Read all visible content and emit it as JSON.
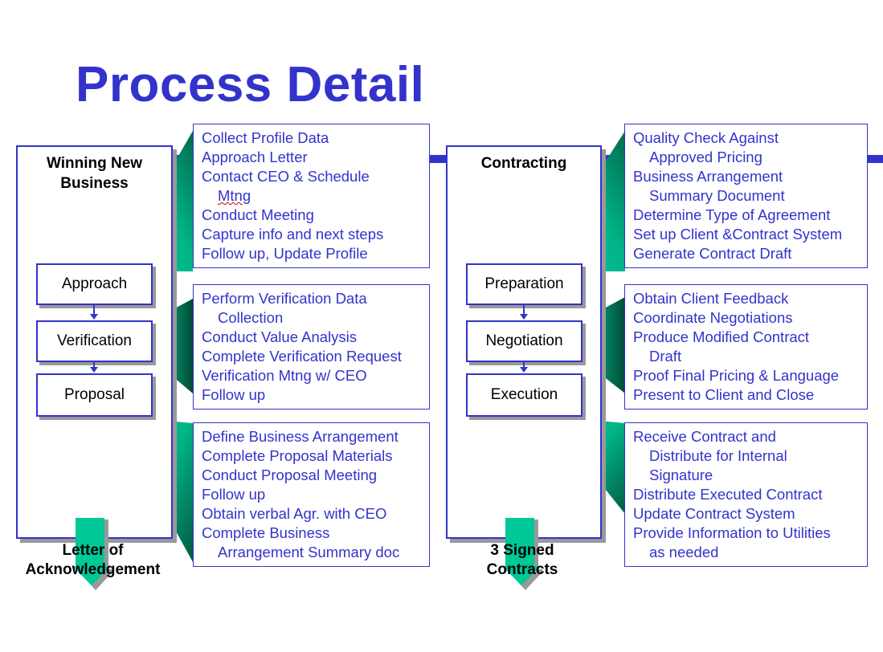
{
  "title": "Process Detail",
  "colors": {
    "accent": "#3333cc",
    "callout_light": "#00c896",
    "callout_dark": "#006a4e",
    "text_dark": "#000000"
  },
  "phases": [
    {
      "title_line1": "Winning New",
      "title_line2": "Business",
      "steps": [
        "Approach",
        "Verification",
        "Proposal"
      ],
      "output_line1": "Letter of",
      "output_line2": "Acknowledgement",
      "details": [
        {
          "lines": [
            {
              "text": "Collect Profile Data",
              "indent": false
            },
            {
              "text": "Approach Letter",
              "indent": false
            },
            {
              "text": "Contact CEO & Schedule",
              "indent": false
            },
            {
              "text": "Mtng",
              "indent": true,
              "spell_flag": true
            },
            {
              "text": "Conduct Meeting",
              "indent": false
            },
            {
              "text": "Capture info and next steps",
              "indent": false
            },
            {
              "text": "Follow up, Update Profile",
              "indent": false
            }
          ]
        },
        {
          "lines": [
            {
              "text": "Perform Verification Data",
              "indent": false
            },
            {
              "text": "Collection",
              "indent": true
            },
            {
              "text": "Conduct Value Analysis",
              "indent": false
            },
            {
              "text": "Complete Verification Request",
              "indent": false
            },
            {
              "text": "Verification Mtng w/ CEO",
              "indent": false
            },
            {
              "text": "Follow up",
              "indent": false
            }
          ]
        },
        {
          "lines": [
            {
              "text": "Define Business Arrangement",
              "indent": false
            },
            {
              "text": "Complete Proposal Materials",
              "indent": false
            },
            {
              "text": "Conduct Proposal Meeting",
              "indent": false
            },
            {
              "text": "Follow up",
              "indent": false
            },
            {
              "text": "Obtain verbal Agr. with CEO",
              "indent": false
            },
            {
              "text": "Complete Business",
              "indent": false
            },
            {
              "text": "Arrangement Summary doc",
              "indent": true
            }
          ]
        }
      ]
    },
    {
      "title_line1": "Contracting",
      "title_line2": "",
      "steps": [
        "Preparation",
        "Negotiation",
        "Execution"
      ],
      "output_line1": "3 Signed",
      "output_line2": "Contracts",
      "details": [
        {
          "lines": [
            {
              "text": "Quality Check Against",
              "indent": false
            },
            {
              "text": "Approved Pricing",
              "indent": true
            },
            {
              "text": "Business Arrangement",
              "indent": false
            },
            {
              "text": "Summary Document",
              "indent": true
            },
            {
              "text": "Determine Type of Agreement",
              "indent": false
            },
            {
              "text": "Set up Client &Contract System",
              "indent": false
            },
            {
              "text": "Generate Contract Draft",
              "indent": false
            }
          ]
        },
        {
          "lines": [
            {
              "text": "Obtain Client Feedback",
              "indent": false
            },
            {
              "text": "Coordinate Negotiations",
              "indent": false
            },
            {
              "text": "Produce Modified Contract",
              "indent": false
            },
            {
              "text": "Draft",
              "indent": true
            },
            {
              "text": "Proof Final Pricing & Language",
              "indent": false
            },
            {
              "text": "Present to Client and Close",
              "indent": false
            }
          ]
        },
        {
          "lines": [
            {
              "text": "Receive Contract and",
              "indent": false
            },
            {
              "text": "Distribute for Internal",
              "indent": true
            },
            {
              "text": "Signature",
              "indent": true
            },
            {
              "text": "Distribute Executed Contract",
              "indent": false
            },
            {
              "text": "Update Contract System",
              "indent": false
            },
            {
              "text": "Provide Information to Utilities",
              "indent": false
            },
            {
              "text": "as needed",
              "indent": true
            }
          ]
        }
      ]
    }
  ]
}
